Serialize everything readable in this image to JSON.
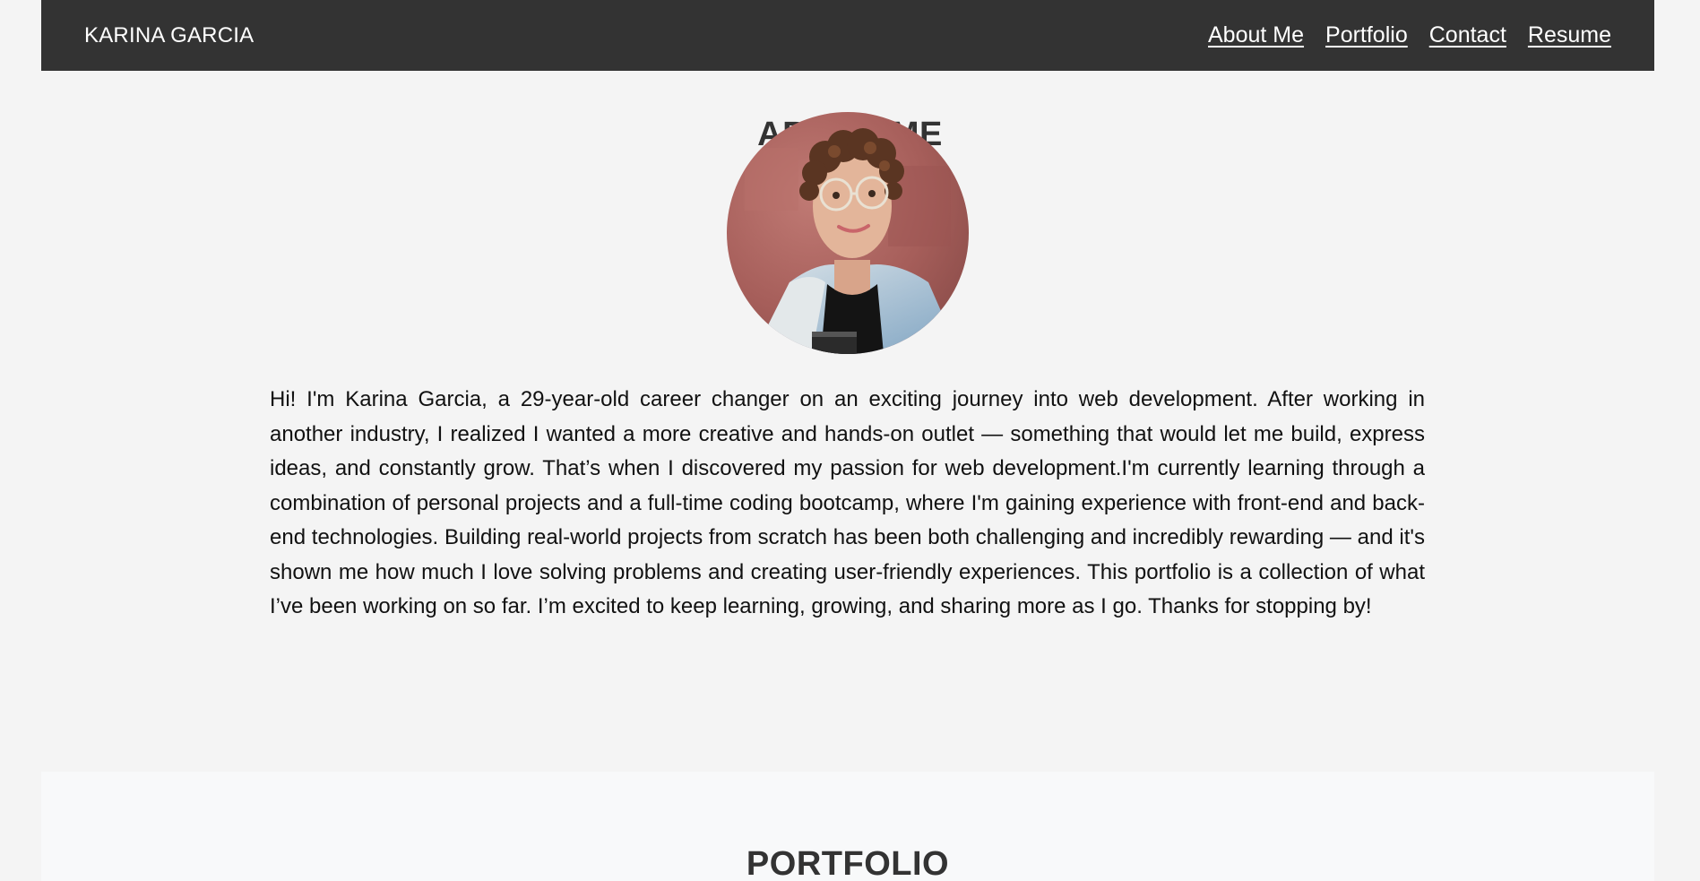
{
  "header": {
    "brand": "KARINA GARCIA",
    "nav": [
      "About Me",
      "Portfolio",
      "Contact",
      "Resume"
    ]
  },
  "about": {
    "title": "ABOUT ME",
    "photo_alt": "Karina Garcia profile photo",
    "bio": "Hi! I'm Karina Garcia, a 29-year-old career changer on an exciting journey into web development. After working in another industry, I realized I wanted a more creative and hands-on outlet — something that would let me build, express ideas, and constantly grow. That’s when I discovered my passion for web development.I'm currently learning through a combination of personal projects and a full-time coding bootcamp, where I'm gaining experience with front-end and back-end technologies. Building real-world projects from scratch has been both challenging and incredibly rewarding — and it's shown me how much I love solving problems and creating user-friendly experiences. This portfolio is a collection of what I’ve been working on so far. I’m excited to keep learning, growing, and sharing more as I go. Thanks for stopping by!"
  },
  "portfolio": {
    "title": "PORTFOLIO"
  },
  "colors": {
    "header_bg": "#333333",
    "page_bg": "#f4f4f4",
    "section_bg": "#f8f9fa",
    "heading": "#333333"
  }
}
